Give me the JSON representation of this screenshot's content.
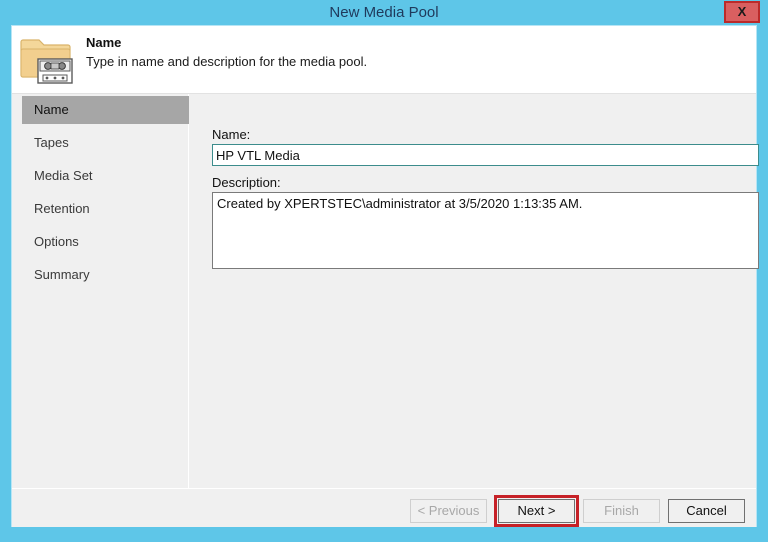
{
  "window": {
    "title": "New Media Pool",
    "close_label": "X"
  },
  "header": {
    "title": "Name",
    "subtitle": "Type in name and description for the media pool.",
    "icon": "folder-tape-icon"
  },
  "sidebar": {
    "items": [
      {
        "label": "Name",
        "selected": true
      },
      {
        "label": "Tapes",
        "selected": false
      },
      {
        "label": "Media Set",
        "selected": false
      },
      {
        "label": "Retention",
        "selected": false
      },
      {
        "label": "Options",
        "selected": false
      },
      {
        "label": "Summary",
        "selected": false
      }
    ]
  },
  "form": {
    "name_label": "Name:",
    "name_value": "HP VTL Media",
    "name_placeholder": "",
    "description_label": "Description:",
    "description_value": "Created by XPERTSTEC\\administrator at 3/5/2020 1:13:35 AM."
  },
  "footer": {
    "previous_label": "< Previous",
    "next_label": "Next >",
    "finish_label": "Finish",
    "cancel_label": "Cancel"
  },
  "colors": {
    "chrome": "#5ec6e8",
    "selection": "#a6a6a6",
    "annotation": "#c62127",
    "close_fill": "#d95f60",
    "focus_border": "#3c8c8c"
  }
}
